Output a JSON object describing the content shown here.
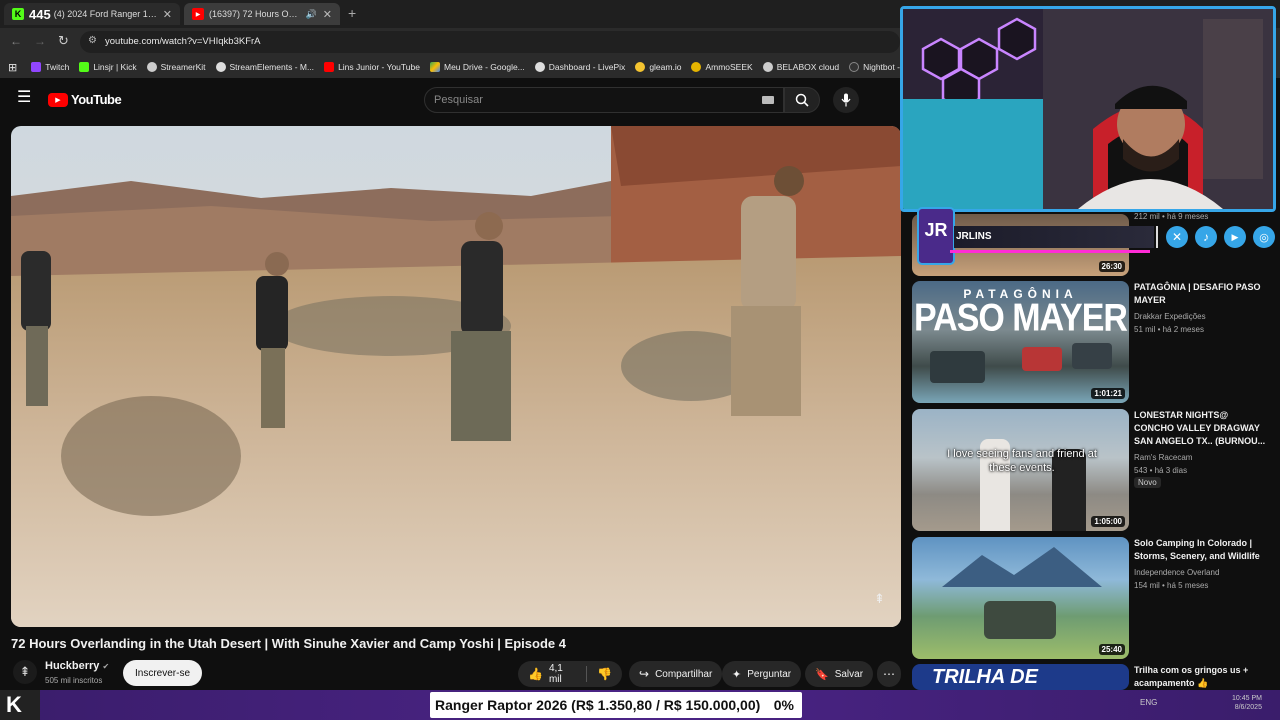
{
  "browser": {
    "tabs": [
      {
        "label": "(4) 2024 Ford Ranger 1FTER4LR6RLE",
        "counter": "445"
      },
      {
        "label": "(16397) 72 Hours Overlandi"
      }
    ],
    "url": "youtube.com/watch?v=VHIqkb3KFrA",
    "bookmarks": [
      "Twitch",
      "Linsjr | Kick",
      "StreamerKit",
      "StreamElements - M...",
      "Lins Junior - YouTube",
      "Meu Drive - Google...",
      "Dashboard - LivePix",
      "gleam.io",
      "AmmoSEEK",
      "BELABOX cloud",
      "Nightbot - Comm"
    ]
  },
  "youtube": {
    "logo_text": "YouTube",
    "search_placeholder": "Pesquisar",
    "video_title": "72 Hours Overlanding in the Utah Desert | With Sinuhe Xavier and Camp Yoshi | Episode 4",
    "channel": {
      "name": "Huckberry",
      "subs": "505 mil inscritos",
      "subscribe_label": "Inscrever-se"
    },
    "actions": {
      "likes": "4,1 mil",
      "share": "Compartilhar",
      "ask": "Perguntar",
      "save": "Salvar"
    }
  },
  "sidebar": {
    "partial_top": {
      "meta": "212 mil • há 9 meses",
      "duration": "26:30"
    },
    "videos": [
      {
        "title": "PATAGÔNIA | DESAFIO PASO MAYER",
        "channel": "Drakkar Expedições",
        "meta": "51 mil • há 2 meses",
        "duration": "1:01:21",
        "thumb_text_top": "PATAGÔNIA",
        "thumb_text_main": "PASO MAYER",
        "badge": ""
      },
      {
        "title": "LONESTAR NIGHTS@ CONCHO VALLEY DRAGWAY SAN ANGELO TX.. (BURNOU...",
        "channel": "Ram's Racecam",
        "meta": "543 • há 3 dias",
        "duration": "1:05:00",
        "thumb_caption": "I love seeing fans and friend at these events.",
        "badge": "Novo"
      },
      {
        "title": "Solo Camping In Colorado | Storms, Scenery, and Wildlife",
        "channel": "Independence Overland",
        "meta": "154 mil • há 5 meses",
        "duration": "25:40",
        "badge": ""
      },
      {
        "title": "Trilha com os gringos us + acampamento 👍",
        "thumb_text": "TRILHA DE",
        "badge": ""
      }
    ]
  },
  "overlay": {
    "streamer_tag": "JRLINS",
    "ticker_text": "Ranger Raptor 2026 (R$ 1.350,80 / R$ 150.000,00)",
    "ticker_percent": "0%",
    "clock_time": "10:45 PM",
    "clock_date": "8/6/2025",
    "lang": "ENG"
  },
  "colors": {
    "youtube_red": "#ff0000",
    "cam_border": "#36a6e8",
    "ticker_purple": "#4b2486"
  }
}
